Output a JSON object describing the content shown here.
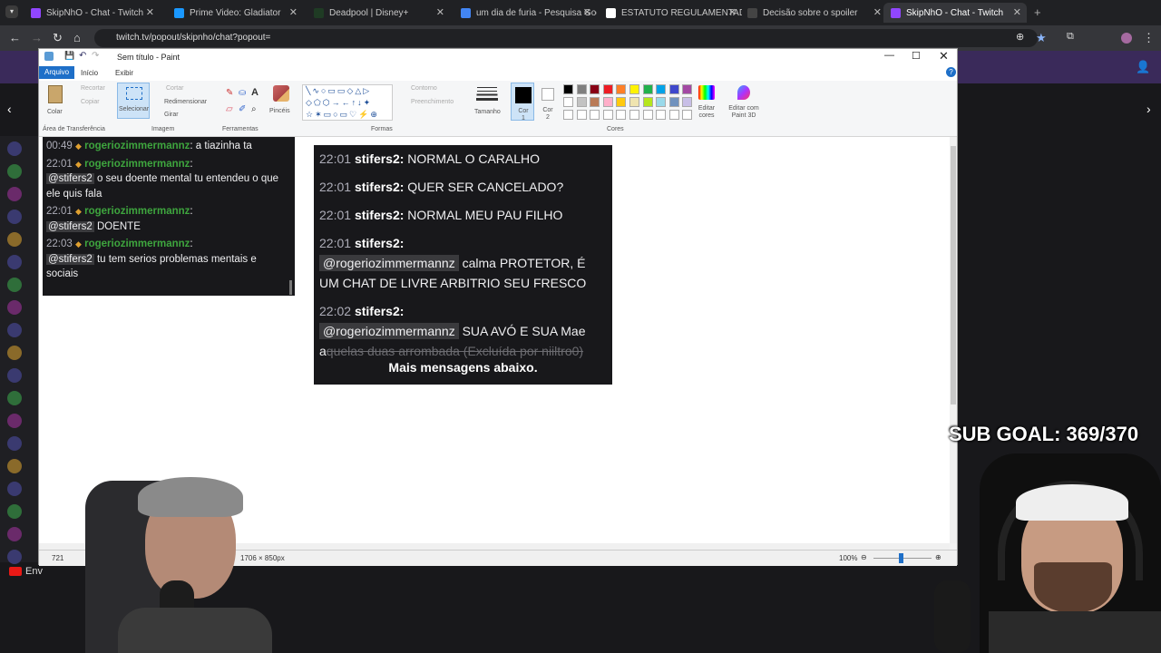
{
  "browser": {
    "tabs": [
      {
        "label": "SkipNhO - Chat - Twitch",
        "active": false
      },
      {
        "label": "Prime Video: Gladiator",
        "active": false
      },
      {
        "label": "Deadpool | Disney+",
        "active": false
      },
      {
        "label": "um dia de furia - Pesquisa Goo",
        "active": false
      },
      {
        "label": "ESTATUTO REGULAMENTADOR",
        "active": false
      },
      {
        "label": "Decisão sobre o spoiler",
        "active": false
      },
      {
        "label": "SkipNhO - Chat - Twitch",
        "active": true
      }
    ],
    "new_tab": "+",
    "url": "twitch.tv/popout/skipnho/chat?popout="
  },
  "paint": {
    "title": "Sem título - Paint",
    "menu_tabs": [
      "Arquivo",
      "Início",
      "Exibir"
    ],
    "clipboard": {
      "paste": "Colar",
      "cut": "Recortar",
      "copy": "Copiar",
      "group": "Área de Transferência"
    },
    "image": {
      "select": "Selecionar",
      "crop": "Cortar",
      "resize": "Redimensionar",
      "rotate": "Girar",
      "group": "Imagem"
    },
    "tools": {
      "group": "Ferramentas",
      "brushes": "Pincéis"
    },
    "shapes": {
      "outline": "Contorno",
      "fill": "Preenchimento",
      "group": "Formas"
    },
    "size": "Tamanho",
    "color1": "Cor 1",
    "color2": "Cor 2",
    "colors_group": "Cores",
    "edit_colors": "Editar cores",
    "edit_3d": "Editar com Paint 3D",
    "status": {
      "dims": "1706 × 850px",
      "zoom": "100%",
      "pos": "721"
    },
    "palette": [
      "#000000",
      "#7f7f7f",
      "#880015",
      "#ed1c24",
      "#ff7f27",
      "#fff200",
      "#22b14c",
      "#00a2e8",
      "#3f48cc",
      "#a349a4",
      "#ffffff",
      "#c3c3c3",
      "#b97a57",
      "#ffaec9",
      "#ffc90e",
      "#efe4b0",
      "#b5e61d",
      "#99d9ea",
      "#7092be",
      "#c8bfe7"
    ]
  },
  "chat_left": [
    {
      "ts": "00:49",
      "user": "rogeriozimmermannz",
      "inline": ": a tiazinha ta",
      "mention": "",
      "text": ""
    },
    {
      "ts": "22:01",
      "user": "rogeriozimmermannz",
      "inline": ":",
      "mention": "@stifers2",
      "text": " o seu doente mental tu entendeu o que ele quis fala"
    },
    {
      "ts": "22:01",
      "user": "rogeriozimmermannz",
      "inline": ":",
      "mention": "@stifers2",
      "text": " DOENTE"
    },
    {
      "ts": "22:03",
      "user": "rogeriozimmermannz",
      "inline": ":",
      "mention": "@stifers2",
      "text": " tu tem serios problemas mentais e sociais"
    }
  ],
  "chat_right": [
    {
      "ts": "22:01",
      "user": "stifers2:",
      "mention": "",
      "text": " NORMAL O CARALHO"
    },
    {
      "ts": "22:01",
      "user": "stifers2:",
      "mention": "",
      "text": " QUER SER CANCELADO?"
    },
    {
      "ts": "22:01",
      "user": "stifers2:",
      "mention": "",
      "text": " NORMAL MEU PAU FILHO"
    },
    {
      "ts": "22:01",
      "user": "stifers2:",
      "mention": "@rogeriozimmermannz",
      "text": " calma PROTETOR, É UM CHAT DE LIVRE ARBITRIO SEU FRESCO"
    },
    {
      "ts": "22:02",
      "user": "stifers2:",
      "mention": "@rogeriozimmermannz",
      "text": " SUA AVÓ E SUA Mae a"
    }
  ],
  "chat_right_deleted": "quelas duas arrombada (Excluída por niiltro0)",
  "more_messages": "Mais mensagens abaixo.",
  "overlay": {
    "sub_goal": "SUB GOAL: 369/370",
    "send_label": "Env"
  }
}
